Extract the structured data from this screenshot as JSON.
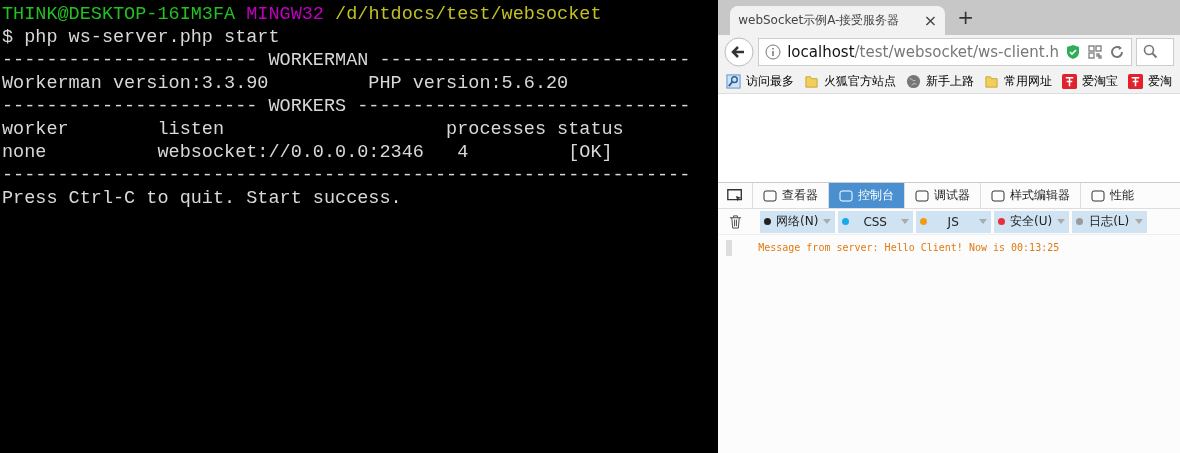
{
  "terminal": {
    "prompt": {
      "user_host": "THINK@DESKTOP-16IM3FA",
      "shell": "MINGW32",
      "path": "/d/htdocs/test/websocket"
    },
    "lines": [
      "$ php ws-server.php start",
      "----------------------- WORKERMAN ----------------------------",
      "Workerman version:3.3.90         PHP version:5.6.20",
      "----------------------- WORKERS ------------------------------",
      "worker        listen                    processes status",
      "none          websocket://0.0.0.0:2346   4         [OK]",
      "--------------------------------------------------------------",
      "Press Ctrl-C to quit. Start success."
    ]
  },
  "browser": {
    "tab": {
      "title": "webSocket示例A-接受服务器",
      "close": "×"
    },
    "new_tab": "+",
    "address": {
      "host": "localhost",
      "path": "/test/websocket/ws-client.h"
    },
    "bookmarks": [
      {
        "label": "访问最多",
        "kind": "search"
      },
      {
        "label": "火狐官方站点",
        "kind": "folder"
      },
      {
        "label": "新手上路",
        "kind": "globe"
      },
      {
        "label": "常用网址",
        "kind": "folder"
      },
      {
        "label": "爱淘宝",
        "kind": "tao"
      },
      {
        "label": "爱淘",
        "kind": "tao"
      }
    ],
    "devtools": {
      "tabs": [
        {
          "label": "查看器",
          "selected": false
        },
        {
          "label": "控制台",
          "selected": true
        },
        {
          "label": "调试器",
          "selected": false
        },
        {
          "label": "样式编辑器",
          "selected": false
        },
        {
          "label": "性能",
          "selected": false
        }
      ],
      "filters": [
        {
          "label": "网络(N)",
          "color": "#222222"
        },
        {
          "label": "CSS",
          "color": "#18a9e6"
        },
        {
          "label": "JS",
          "color": "#f39c12"
        },
        {
          "label": "安全(U)",
          "color": "#e8303a"
        },
        {
          "label": "日志(L)",
          "color": "#9a9a9a"
        }
      ],
      "messages": [
        "Message from server: Hello Client! Now is 00:13:25"
      ]
    }
  }
}
